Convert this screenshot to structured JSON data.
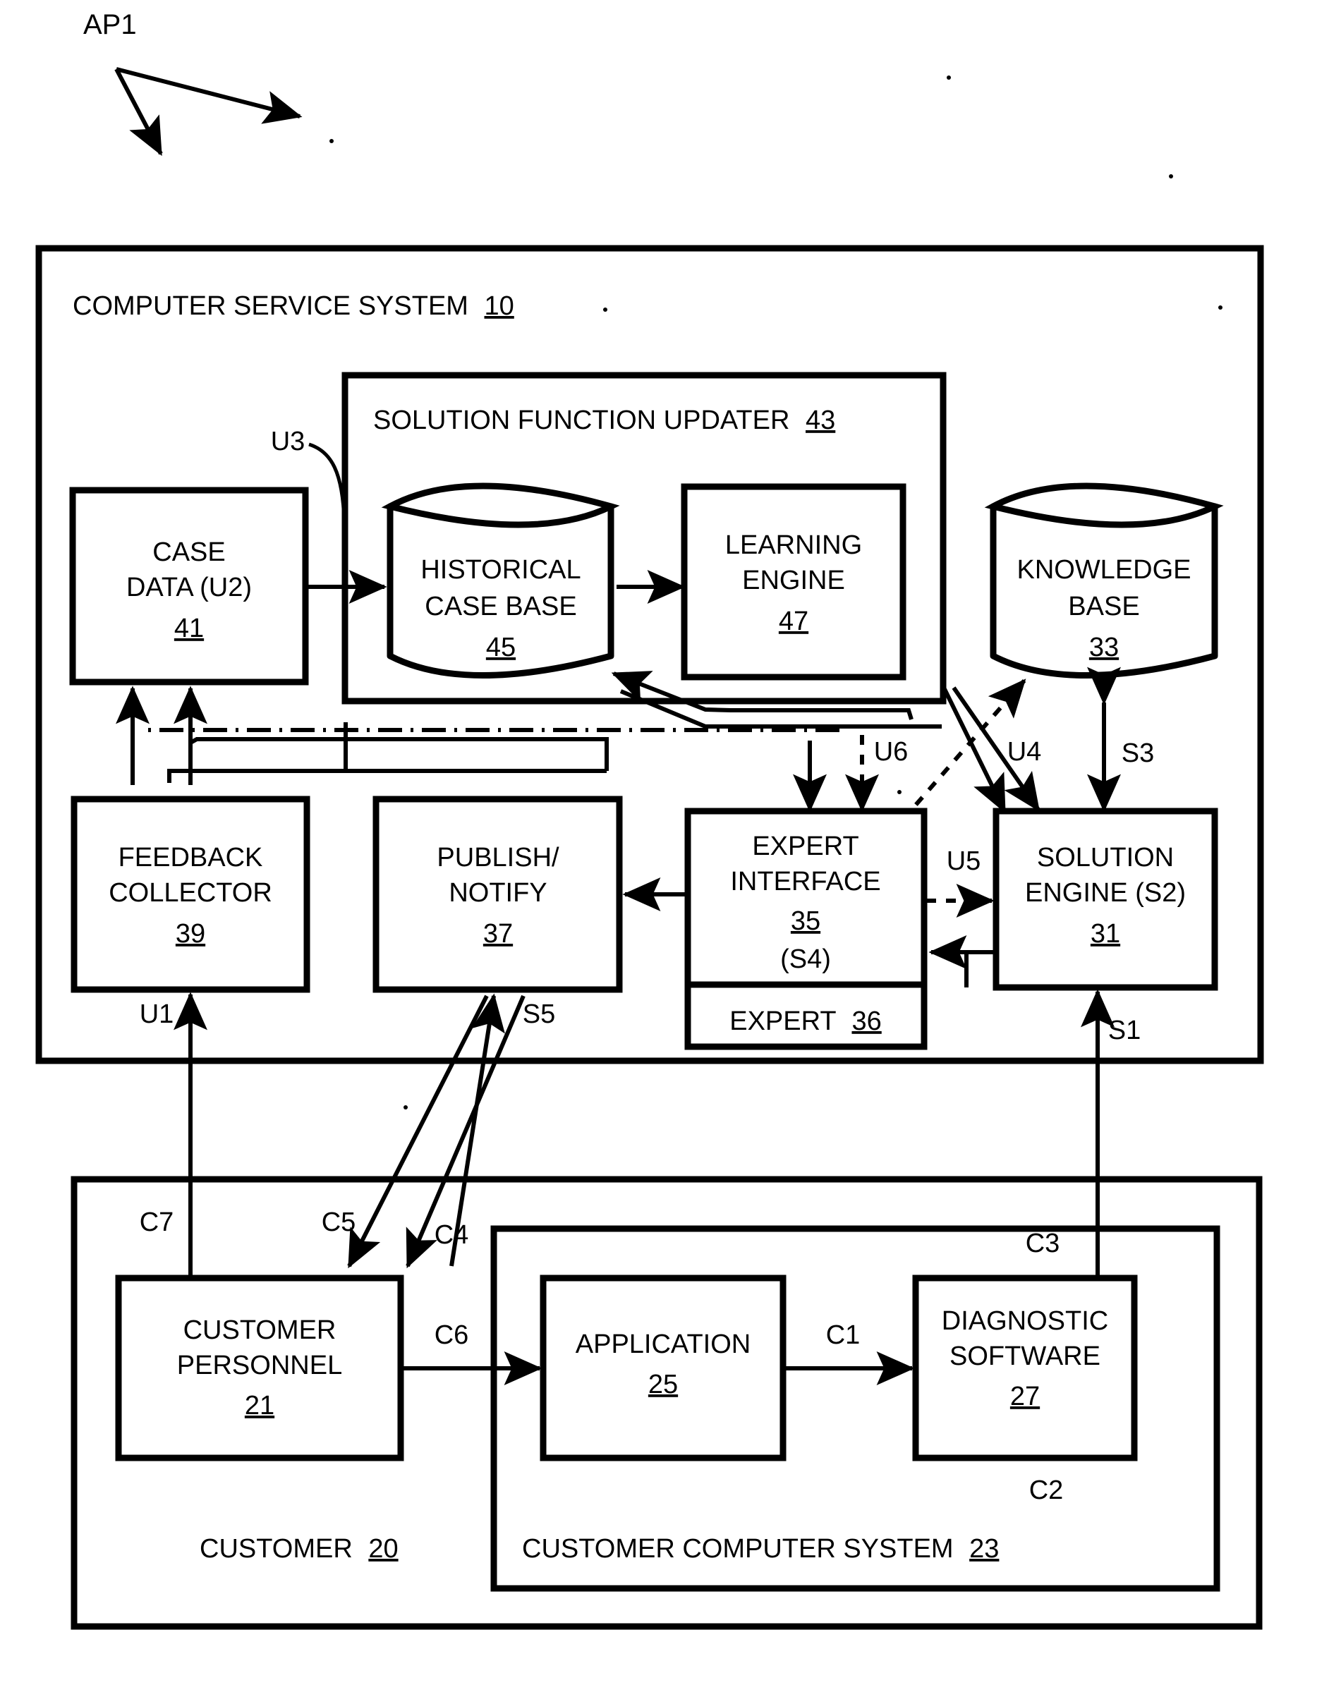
{
  "figure": {
    "callout_label": "AP1",
    "colors": {
      "ink": "#000000",
      "paper": "#ffffff"
    }
  },
  "frames": [
    {
      "id": "service_system",
      "label": "COMPUTER SERVICE SYSTEM",
      "ref": "10"
    },
    {
      "id": "solution_function_updater",
      "label": "SOLUTION FUNCTION UPDATER",
      "ref": "43"
    },
    {
      "id": "customer",
      "label": "CUSTOMER",
      "ref": "20"
    },
    {
      "id": "customer_computer_system",
      "label": "CUSTOMER COMPUTER SYSTEM",
      "ref": "23"
    }
  ],
  "nodes": [
    {
      "id": "case_data",
      "shape": "rect",
      "lines": [
        "CASE",
        "DATA (U2)"
      ],
      "ref": "41"
    },
    {
      "id": "historical_case_base",
      "shape": "cylinder",
      "lines": [
        "HISTORICAL",
        "CASE BASE"
      ],
      "ref": "45"
    },
    {
      "id": "learning_engine",
      "shape": "rect",
      "lines": [
        "LEARNING",
        "ENGINE"
      ],
      "ref": "47"
    },
    {
      "id": "knowledge_base",
      "shape": "cylinder",
      "lines": [
        "KNOWLEDGE",
        "BASE"
      ],
      "ref": "33"
    },
    {
      "id": "feedback_collector",
      "shape": "rect",
      "lines": [
        "FEEDBACK",
        "COLLECTOR"
      ],
      "ref": "39"
    },
    {
      "id": "publish_notify",
      "shape": "rect",
      "lines": [
        "PUBLISH/",
        "NOTIFY"
      ],
      "ref": "37"
    },
    {
      "id": "expert_interface",
      "shape": "rect",
      "lines": [
        "EXPERT",
        "INTERFACE"
      ],
      "ref": "35",
      "sub": "(S4)"
    },
    {
      "id": "expert",
      "shape": "rect",
      "lines": [
        "EXPERT"
      ],
      "ref": "36",
      "inline": true
    },
    {
      "id": "solution_engine",
      "shape": "rect",
      "lines": [
        "SOLUTION",
        "ENGINE (S2)"
      ],
      "ref": "31"
    },
    {
      "id": "customer_personnel",
      "shape": "rect",
      "lines": [
        "CUSTOMER",
        "PERSONNEL"
      ],
      "ref": "21"
    },
    {
      "id": "application",
      "shape": "rect",
      "lines": [
        "APPLICATION"
      ],
      "ref": "25"
    },
    {
      "id": "diagnostic_software",
      "shape": "rect",
      "lines": [
        "DIAGNOSTIC",
        "SOFTWARE"
      ],
      "ref": "27"
    }
  ],
  "flow_labels": {
    "u1": "U1",
    "u2": "U2",
    "u3": "U3",
    "u4": "U4",
    "u5": "U5",
    "u6": "U6",
    "s1": "S1",
    "s2": "S2",
    "s3": "S3",
    "s4": "S4",
    "s5": "S5",
    "c1": "C1",
    "c2": "C2",
    "c3": "C3",
    "c4": "C4",
    "c5": "C5",
    "c6": "C6",
    "c7": "C7"
  }
}
